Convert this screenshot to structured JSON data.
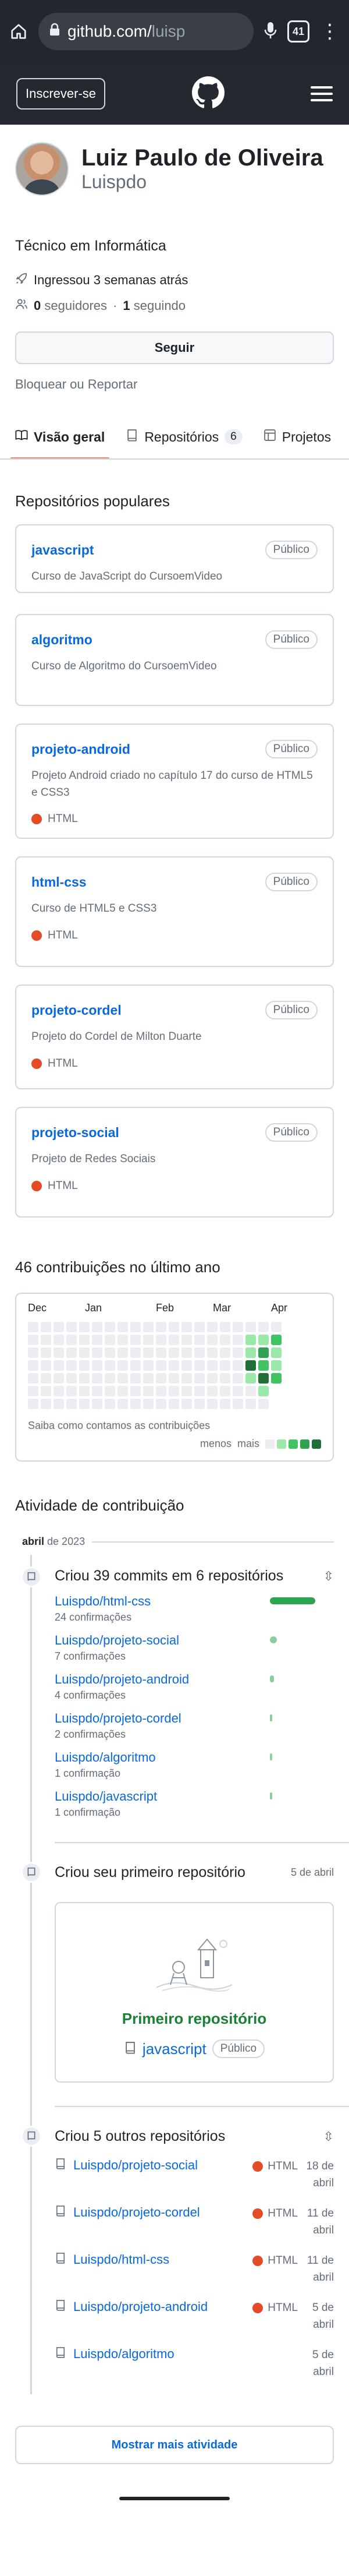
{
  "browser": {
    "url_host": "github.com/",
    "url_path": "luisp",
    "tab_count": "41"
  },
  "header": {
    "signup_label": "Inscrever-se"
  },
  "profile": {
    "name": "Luiz Paulo de Oliveira",
    "login": "Luispdo",
    "bio": "Técnico em Informática",
    "joined": "Ingressou 3 semanas atrás",
    "followers": "0",
    "followers_label": "seguidores",
    "following": "1",
    "following_label": "seguindo",
    "follow_button": "Seguir",
    "block_link": "Bloquear ou Reportar"
  },
  "tabs": [
    {
      "label": "Visão geral"
    },
    {
      "label": "Repositórios",
      "count": "6"
    },
    {
      "label": "Projetos"
    }
  ],
  "pinned": {
    "title": "Repositórios populares",
    "repos": [
      {
        "name": "javascript",
        "badge": "Público",
        "description": "Curso de JavaScript do CursoemVideo",
        "language": ""
      },
      {
        "name": "algoritmo",
        "badge": "Público",
        "description": "Curso de Algoritmo do CursoemVideo",
        "language": ""
      },
      {
        "name": "projeto-android",
        "badge": "Público",
        "description": "Projeto Android criado no capítulo 17 do curso de HTML5 e CSS3",
        "language": "HTML"
      },
      {
        "name": "html-css",
        "badge": "Público",
        "description": "Curso de HTML5 e CSS3",
        "language": "HTML"
      },
      {
        "name": "projeto-cordel",
        "badge": "Público",
        "description": "Projeto do Cordel de Milton Duarte",
        "language": "HTML"
      },
      {
        "name": "projeto-social",
        "badge": "Público",
        "description": "Projeto de Redes Sociais",
        "language": "HTML"
      }
    ],
    "language_color": "#e34c26"
  },
  "contributions": {
    "title": "46 contribuições no último ano",
    "months": [
      "Dec",
      "Jan",
      "Feb",
      "Mar",
      "Apr"
    ],
    "footer": "Saiba como contamos as contribuições",
    "legend_less": "menos",
    "legend_more": "mais",
    "levels": [
      [
        0,
        0,
        0,
        0,
        0,
        0,
        0,
        0,
        0,
        0,
        0,
        0,
        0,
        0,
        0,
        0,
        0,
        0,
        0,
        0
      ],
      [
        0,
        0,
        0,
        0,
        0,
        0,
        0,
        0,
        0,
        0,
        0,
        0,
        0,
        0,
        0,
        0,
        0,
        1,
        1,
        2
      ],
      [
        0,
        0,
        0,
        0,
        0,
        0,
        0,
        0,
        0,
        0,
        0,
        0,
        0,
        0,
        0,
        0,
        0,
        1,
        3,
        1
      ],
      [
        0,
        0,
        0,
        0,
        0,
        0,
        0,
        0,
        0,
        0,
        0,
        0,
        0,
        0,
        0,
        0,
        0,
        4,
        2,
        1
      ],
      [
        0,
        0,
        0,
        0,
        0,
        0,
        0,
        0,
        0,
        0,
        0,
        0,
        0,
        0,
        0,
        0,
        0,
        1,
        4,
        2
      ],
      [
        0,
        0,
        0,
        0,
        0,
        0,
        0,
        0,
        0,
        0,
        0,
        0,
        0,
        0,
        0,
        0,
        0,
        0,
        1,
        -1
      ],
      [
        0,
        0,
        0,
        0,
        0,
        0,
        0,
        0,
        0,
        0,
        0,
        0,
        0,
        0,
        0,
        0,
        0,
        0,
        0,
        -1
      ]
    ]
  },
  "activity": {
    "title": "Atividade de contribuição",
    "month": "abril",
    "year_text": "de 2023",
    "commits": {
      "summary": "Criou 39 commits em 6 repositórios",
      "rows": [
        {
          "repo": "Luispdo/html-css",
          "count_text": "24 confirmações",
          "fraction": 1.0
        },
        {
          "repo": "Luispdo/projeto-social",
          "count_text": "7 confirmações",
          "fraction": 0.16
        },
        {
          "repo": "Luispdo/projeto-android",
          "count_text": "4 confirmações",
          "fraction": 0.09
        },
        {
          "repo": "Luispdo/projeto-cordel",
          "count_text": "2 confirmações",
          "fraction": 0.05
        },
        {
          "repo": "Luispdo/algoritmo",
          "count_text": "1 confirmação",
          "fraction": 0.02
        },
        {
          "repo": "Luispdo/javascript",
          "count_text": "1 confirmação",
          "fraction": 0.02
        }
      ]
    },
    "first_repo": {
      "summary": "Criou seu primeiro repositório",
      "date": "5 de abril",
      "card_title": "Primeiro repositório",
      "repo": "javascript",
      "badge": "Público"
    },
    "other_repos": {
      "summary": "Criou 5 outros repositórios",
      "rows": [
        {
          "repo": "Luispdo/projeto-social",
          "language": "HTML",
          "date": "18 de abril"
        },
        {
          "repo": "Luispdo/projeto-cordel",
          "language": "HTML",
          "date": "11 de abril"
        },
        {
          "repo": "Luispdo/html-css",
          "language": "HTML",
          "date": "11 de abril"
        },
        {
          "repo": "Luispdo/projeto-android",
          "language": "HTML",
          "date": "5 de abril"
        },
        {
          "repo": "Luispdo/algoritmo",
          "language": "",
          "date": "5 de abril"
        }
      ]
    },
    "more_button": "Mostrar mais atividade"
  }
}
